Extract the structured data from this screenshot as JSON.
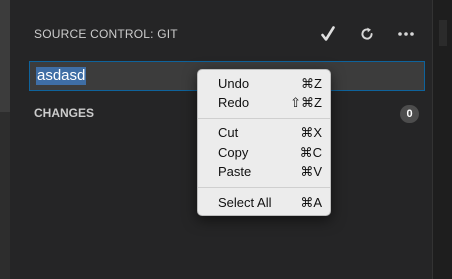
{
  "header": {
    "title": "SOURCE CONTROL: GIT",
    "icons": [
      "checkmark-icon",
      "refresh-icon",
      "more-icon"
    ]
  },
  "commit_input": {
    "value": "asdasd"
  },
  "changes": {
    "label": "CHANGES",
    "count": "0"
  },
  "context_menu": {
    "groups": [
      [
        {
          "label": "Undo",
          "shortcut": "⌘Z"
        },
        {
          "label": "Redo",
          "shortcut": "⇧⌘Z"
        }
      ],
      [
        {
          "label": "Cut",
          "shortcut": "⌘X"
        },
        {
          "label": "Copy",
          "shortcut": "⌘C"
        },
        {
          "label": "Paste",
          "shortcut": "⌘V"
        }
      ],
      [
        {
          "label": "Select All",
          "shortcut": "⌘A"
        }
      ]
    ]
  },
  "colors": {
    "panel_background": "#252526",
    "input_border": "#0e639c",
    "selection": "#3f6ea5",
    "menu_background": "#ececec"
  }
}
